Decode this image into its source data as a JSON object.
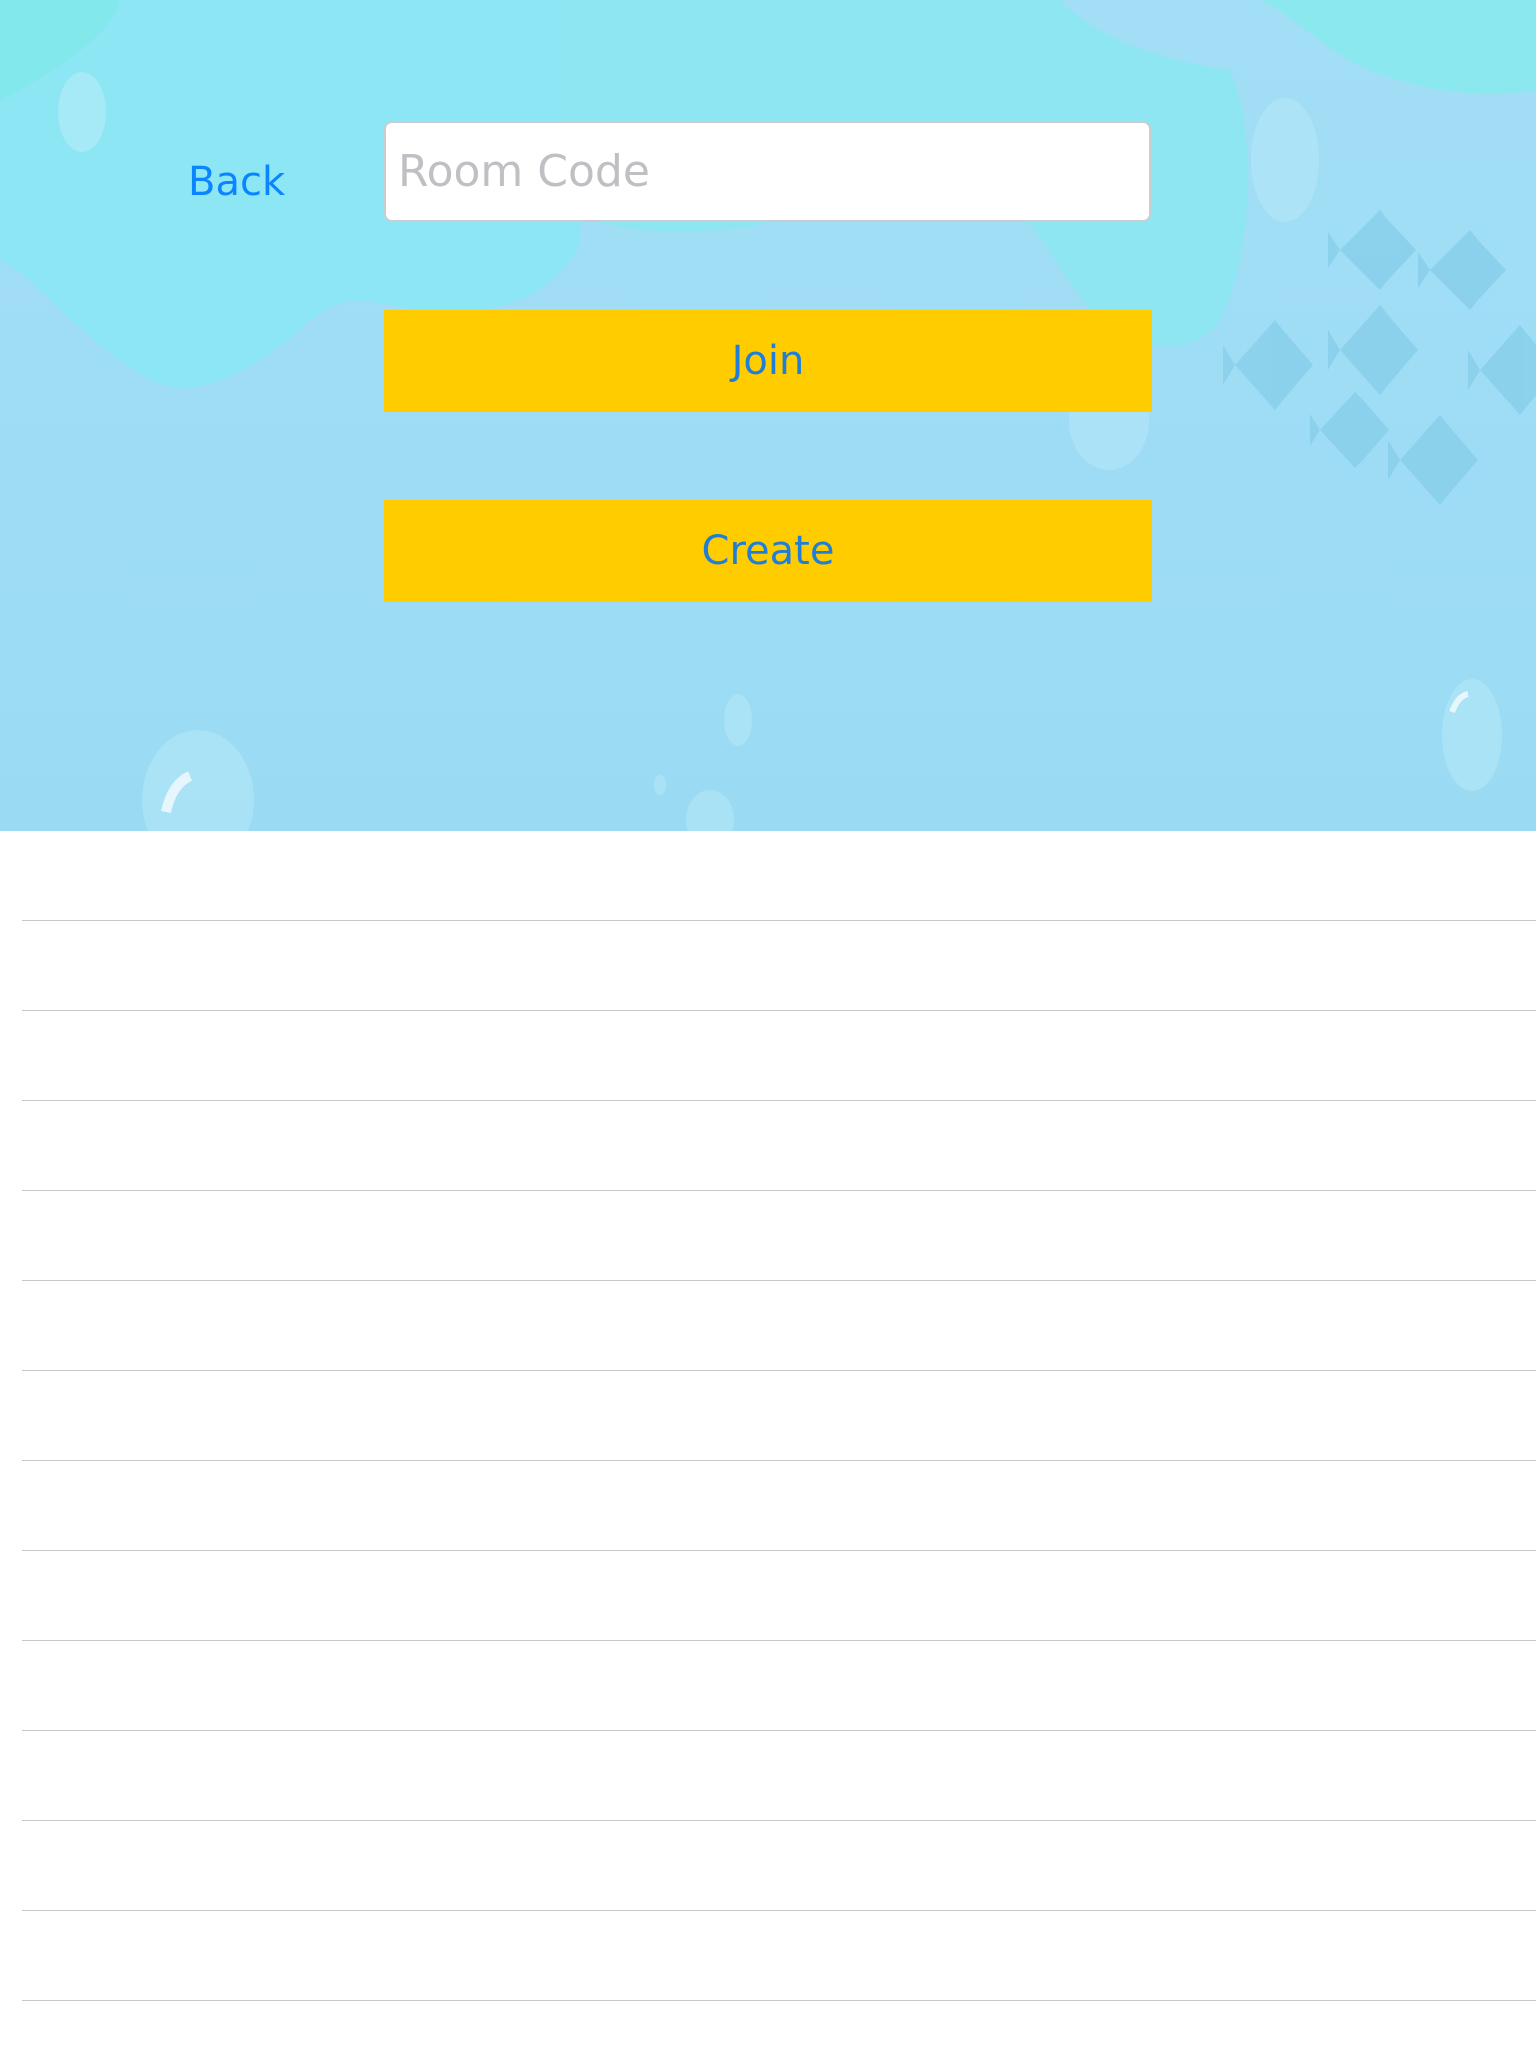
{
  "back_label": "Back",
  "room_code": {
    "value": "",
    "placeholder": "Room Code"
  },
  "buttons": {
    "join_label": "Join",
    "create_label": "Create"
  },
  "room_list": {
    "row_count": 13
  },
  "colors": {
    "accent": "#0a84ff",
    "button_fill": "#ffcc00",
    "button_text": "#1f7fd8",
    "water": "#9edcf5",
    "separator": "#c8c7cc"
  }
}
